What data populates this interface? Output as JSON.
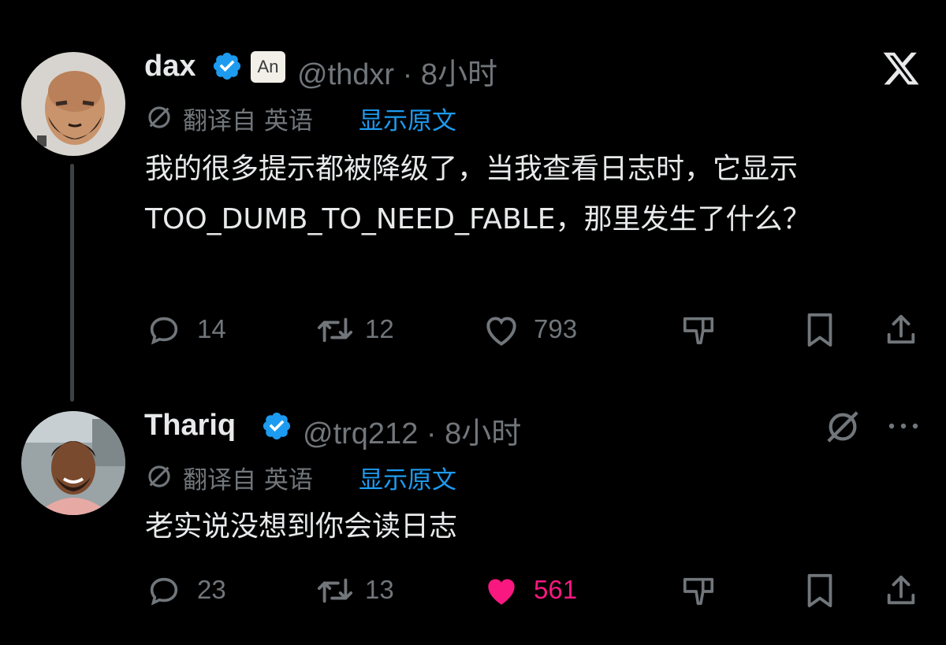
{
  "tweets": [
    {
      "author_name": "dax",
      "handle_time": "@thdxr · 8小时",
      "affiliate_badge": "An",
      "translated_label": "翻译自 英语",
      "show_original": "显示原文",
      "text": "我的很多提示都被降级了，当我查看日志时，它显示 TOO_DUMB_TO_NEED_FABLE，那里发生了什么？",
      "replies": "14",
      "retweets": "12",
      "likes": "793",
      "liked": false
    },
    {
      "author_name": "Thariq",
      "handle_time": "@trq212 · 8小时",
      "translated_label": "翻译自 英语",
      "show_original": "显示原文",
      "text": "老实说没想到你会读日志",
      "replies": "23",
      "retweets": "13",
      "likes": "561",
      "liked": true
    }
  ],
  "colors": {
    "background": "#000000",
    "text": "#e7e9ea",
    "muted": "#71767b",
    "link": "#1d9bf0",
    "like_active": "#f91880",
    "verified": "#1d9bf0"
  },
  "icons": [
    "x-logo-icon",
    "verified-icon",
    "translate-icon",
    "reply-icon",
    "retweet-icon",
    "heart-icon",
    "downvote-icon",
    "bookmark-icon",
    "share-icon",
    "grok-icon",
    "more-icon"
  ]
}
